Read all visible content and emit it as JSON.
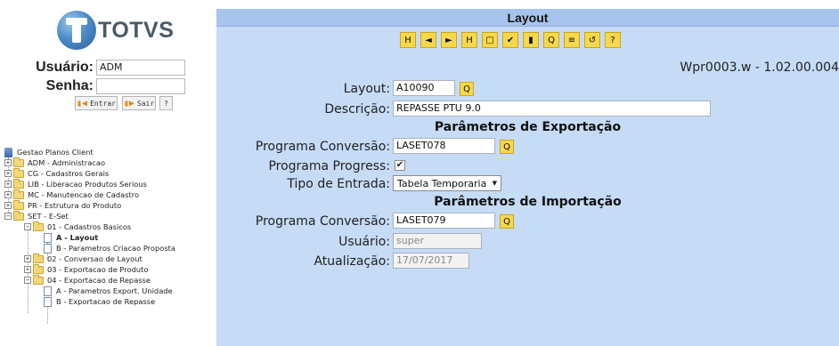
{
  "brand": {
    "name": "TOTVS"
  },
  "login": {
    "user_label": "Usuário:",
    "user_value": "ADM",
    "password_label": "Senha:",
    "password_value": "",
    "enter_label": "Entrar",
    "exit_label": "Sair",
    "help_label": "?"
  },
  "tree": {
    "root": "Gestao Planos Client",
    "items": [
      "ADM - Administracao",
      "CG - Cadastros Gerais",
      "LIB - Liberacao Produtos Serious",
      "MC - Manutencao de Cadastro",
      "PR - Estrutura do Produto",
      "SET - E-Set",
      "01 - Cadastros Basicos",
      "A - Layout",
      "B - Parametros Criacao Proposta",
      "02 - Conversao de Layout",
      "03 - Exportacao de Produto",
      "04 - Exportacao de Repasse",
      "A - Parametros Export. Unidade",
      "B - Exportacao de Repasse"
    ]
  },
  "main": {
    "title": "Layout",
    "toolbar": [
      "H",
      "◄",
      "►",
      "H",
      "▢",
      "✔",
      "▮",
      "Q",
      "≡",
      "↺",
      "?"
    ],
    "version": "Wpr0003.w - 1.02.00.004",
    "layout_label": "Layout:",
    "layout_value": "A10090",
    "descricao_label": "Descrição:",
    "descricao_value": "REPASSE PTU 9.0",
    "export_title": "Parâmetros de Exportação",
    "prog_conv_label": "Programa Conversão:",
    "prog_conv_export_value": "LASET078",
    "prog_progress_label": "Programa Progress:",
    "prog_progress_checked": "✔",
    "tipo_entrada_label": "Tipo de Entrada:",
    "tipo_entrada_value": "Tabela Temporaria",
    "import_title": "Parâmetros de Importação",
    "prog_conv_import_value": "LASET079",
    "usuario_label": "Usuário:",
    "usuario_value": "super",
    "atualizacao_label": "Atualização:",
    "atualizacao_value": "17/07/2017",
    "zoom_icon": "Q"
  }
}
